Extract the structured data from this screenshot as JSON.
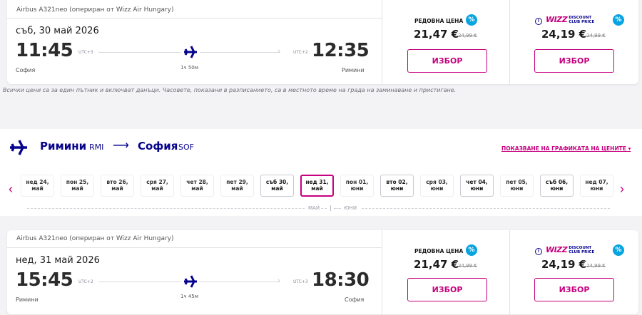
{
  "flight1": {
    "aircraft": "Airbus A321neo (опериран от Wizz Air Hungary)",
    "date": "съб, 30 май 2026",
    "dep_time": "11:45",
    "dep_utc": "UTC+3",
    "arr_time": "12:35",
    "arr_utc": "UTC+2",
    "dep_city": "София",
    "arr_city": "Римини",
    "duration": "1ч 50м",
    "regular": {
      "title": "РЕДОВНА ЦЕНА",
      "price": "21,47 €",
      "old": "24,99 €",
      "button": "ИЗБОР"
    },
    "club": {
      "brand": "WIZZ",
      "line1": "DISCOUNT",
      "line2": "CLUB PRICE",
      "price": "24,19 €",
      "old": "24,99 €",
      "button": "ИЗБОР"
    }
  },
  "note": "Всички цени са за един пътник и включват данъци. Часовете, показани в разписанието, са в местното време на града на заминаване и пристигане.",
  "route": {
    "from": "Римини",
    "from_code": "RMI",
    "arrow": "⟶",
    "to": "София",
    "to_code": "SOF",
    "chart_link": "ПОКАЗВАНЕ НА ГРАФИКАТА НА ЦЕНИТЕ ▾"
  },
  "days": {
    "prev": "‹",
    "next": "›",
    "items": [
      {
        "l1": "нед 24,",
        "l2": "май",
        "avail": false,
        "sel": false
      },
      {
        "l1": "пон 25,",
        "l2": "май",
        "avail": false,
        "sel": false
      },
      {
        "l1": "вто 26,",
        "l2": "май",
        "avail": false,
        "sel": false
      },
      {
        "l1": "сря 27,",
        "l2": "май",
        "avail": false,
        "sel": false
      },
      {
        "l1": "чет 28,",
        "l2": "май",
        "avail": false,
        "sel": false
      },
      {
        "l1": "пет 29,",
        "l2": "май",
        "avail": false,
        "sel": false
      },
      {
        "l1": "съб 30,",
        "l2": "май",
        "avail": true,
        "sel": false
      },
      {
        "l1": "нед 31,",
        "l2": "май",
        "avail": true,
        "sel": true
      },
      {
        "l1": "пон 01,",
        "l2": "юни",
        "avail": false,
        "sel": false
      },
      {
        "l1": "вто 02,",
        "l2": "юни",
        "avail": true,
        "sel": false
      },
      {
        "l1": "сря 03,",
        "l2": "юни",
        "avail": false,
        "sel": false
      },
      {
        "l1": "чет 04,",
        "l2": "юни",
        "avail": true,
        "sel": false
      },
      {
        "l1": "пет 05,",
        "l2": "юни",
        "avail": false,
        "sel": false
      },
      {
        "l1": "съб 06,",
        "l2": "юни",
        "avail": true,
        "sel": false
      },
      {
        "l1": "нед 07,",
        "l2": "юни",
        "avail": false,
        "sel": false
      }
    ],
    "month_may": "МАЙ",
    "month_june": "ЮНИ"
  },
  "flight2": {
    "aircraft": "Airbus A321neo (опериран от Wizz Air Hungary)",
    "date": "нед, 31 май 2026",
    "dep_time": "15:45",
    "dep_utc": "UTC+2",
    "arr_time": "18:30",
    "arr_utc": "UTC+3",
    "dep_city": "Римини",
    "arr_city": "София",
    "duration": "1ч 45м",
    "regular": {
      "title": "РЕДОВНА ЦЕНА",
      "price": "21,47 €",
      "old": "24,99 €",
      "button": "ИЗБОР"
    },
    "club": {
      "brand": "WIZZ",
      "line1": "DISCOUNT",
      "line2": "CLUB PRICE",
      "price": "24,19 €",
      "old": "24,99 €",
      "button": "ИЗБОР"
    }
  },
  "colors": {
    "navy": "#06038d",
    "magenta": "#c6007e",
    "badge": "#06a4e0"
  },
  "icons": [
    "plane-icon",
    "percent-icon",
    "info-icon",
    "chevron-left-icon",
    "chevron-right-icon"
  ]
}
